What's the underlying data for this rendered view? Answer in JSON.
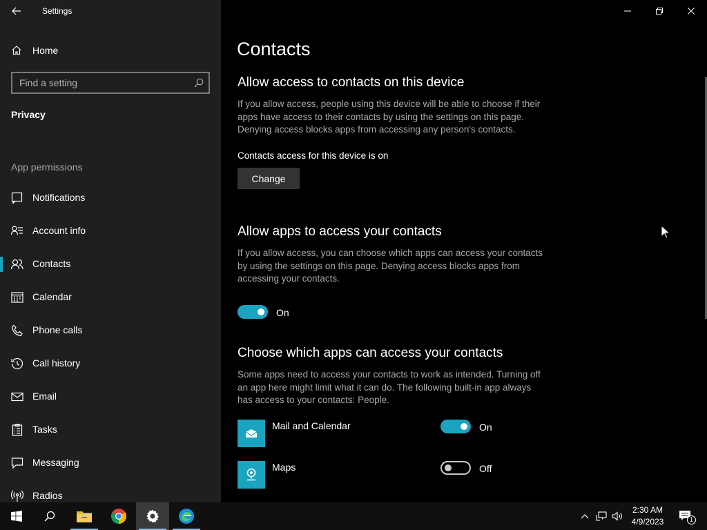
{
  "window": {
    "title": "Settings"
  },
  "sidebar": {
    "home_label": "Home",
    "search_placeholder": "Find a setting",
    "section": "Privacy",
    "group_label": "App permissions",
    "items": [
      {
        "label": "Notifications",
        "icon": "notification-icon"
      },
      {
        "label": "Account info",
        "icon": "account-info-icon"
      },
      {
        "label": "Contacts",
        "icon": "contacts-icon",
        "active": true
      },
      {
        "label": "Calendar",
        "icon": "calendar-icon"
      },
      {
        "label": "Phone calls",
        "icon": "phone-icon"
      },
      {
        "label": "Call history",
        "icon": "history-icon"
      },
      {
        "label": "Email",
        "icon": "email-icon"
      },
      {
        "label": "Tasks",
        "icon": "tasks-icon"
      },
      {
        "label": "Messaging",
        "icon": "messaging-icon"
      },
      {
        "label": "Radios",
        "icon": "radios-icon"
      }
    ]
  },
  "main": {
    "page_title": "Contacts",
    "device_section": {
      "heading": "Allow access to contacts on this device",
      "description": "If you allow access, people using this device will be able to choose if their apps have access to their contacts by using the settings on this page. Denying access blocks apps from accessing any person's contacts.",
      "status": "Contacts access for this device is on",
      "button_label": "Change"
    },
    "apps_section": {
      "heading": "Allow apps to access your contacts",
      "description": "If you allow access, you can choose which apps can access your contacts by using the settings on this page. Denying access blocks apps from accessing your contacts.",
      "toggle_state": "On"
    },
    "choose_section": {
      "heading": "Choose which apps can access your contacts",
      "description": "Some apps need to access your contacts to work as intended. Turning off an app here might limit what it can do. The following built-in app always has access to your contacts: People.",
      "apps": [
        {
          "name": "Mail and Calendar",
          "state": "On",
          "icon": "mail-calendar-icon"
        },
        {
          "name": "Maps",
          "state": "Off",
          "icon": "maps-icon"
        }
      ]
    }
  },
  "taskbar": {
    "apps": [
      "start-icon",
      "search-icon",
      "file-explorer-icon",
      "chrome-icon",
      "settings-icon",
      "edge-icon"
    ],
    "time": "2:30 AM",
    "date": "4/9/2023",
    "notification_count": "1"
  },
  "colors": {
    "accent": "#1aa4c0",
    "sidebar_bg": "#1f1f1f",
    "content_bg": "#000000",
    "taskbar_bg": "#101010"
  }
}
